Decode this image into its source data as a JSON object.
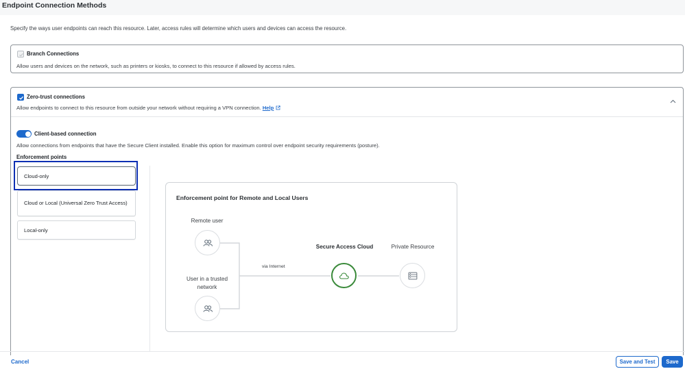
{
  "page": {
    "title": "Endpoint Connection Methods",
    "intro": "Specify the ways user endpoints can reach this resource. Later, access rules will determine which users and devices can access the resource."
  },
  "branch": {
    "title": "Branch Connections",
    "description": "Allow users and devices on the network, such as printers or kiosks, to connect to this resource if allowed by access rules.",
    "checked": false
  },
  "zero_trust": {
    "title": "Zero-trust connections",
    "description": "Allow endpoints to connect to this resource from outside your network without requiring a VPN connection.",
    "help_label": "Help",
    "checked": true,
    "client_based": {
      "title": "Client-based connection",
      "description": "Allow connections from endpoints that have the Secure Client installed. Enable this option for maximum control over endpoint security requirements (posture).",
      "enabled": true
    },
    "enforcement": {
      "label": "Enforcement points",
      "options": [
        "Cloud-only",
        "Cloud or Local (Universal Zero Trust Access)",
        "Local-only"
      ],
      "selected": "Cloud-only"
    }
  },
  "diagram": {
    "title": "Enforcement point for Remote and Local Users",
    "remote_user": "Remote user",
    "trusted_user": "User in a trusted network",
    "via": "via Internet",
    "cloud": "Secure Access Cloud",
    "resource": "Private Resource"
  },
  "footer": {
    "cancel": "Cancel",
    "save_and_test": "Save and Test",
    "save": "Save"
  },
  "colors": {
    "accent": "#1d69cc",
    "highlight": "#0d2fb3",
    "cloud_green": "#3a8a3a"
  }
}
